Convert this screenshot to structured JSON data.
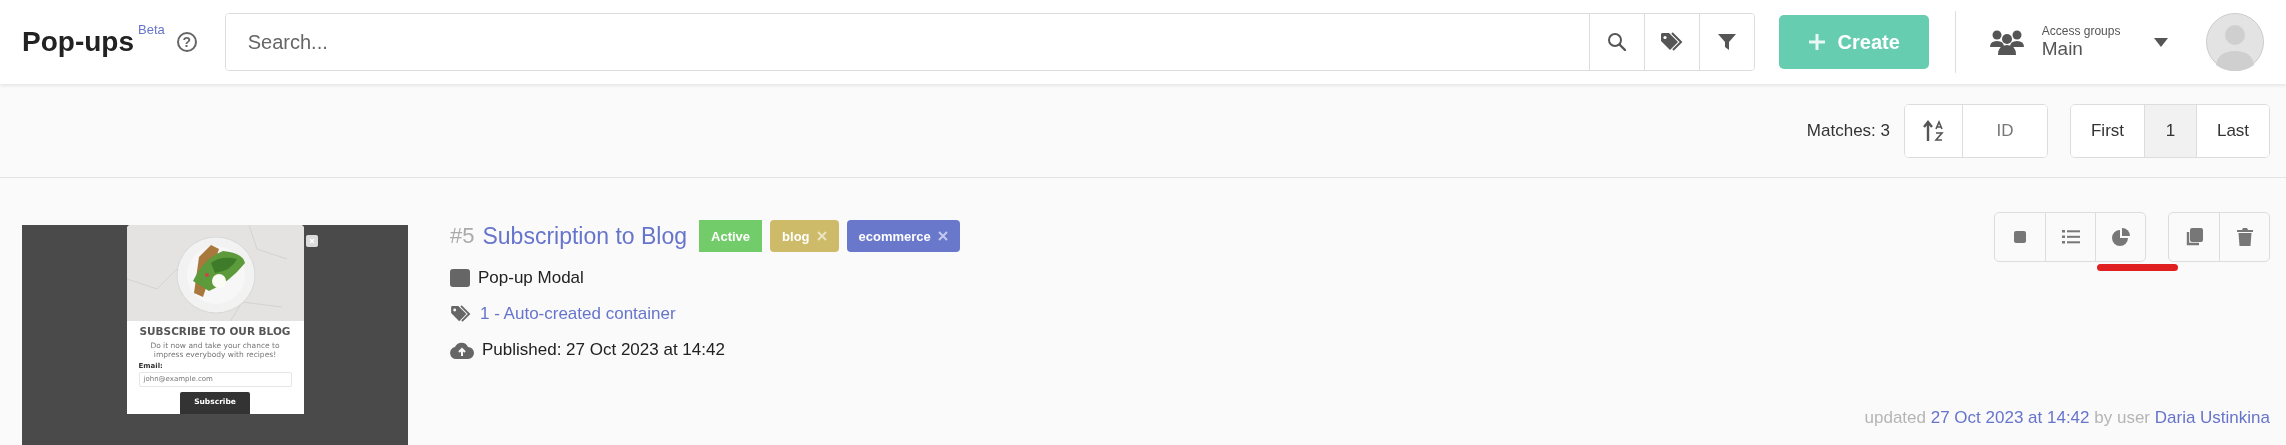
{
  "header": {
    "title": "Pop-ups",
    "badge": "Beta",
    "help_icon": "?",
    "search": {
      "placeholder": "Search..."
    },
    "create_button": "Create",
    "access_groups": {
      "label": "Access groups",
      "value": "Main"
    }
  },
  "toolbar": {
    "matches": "Matches: 3",
    "sort_field": "ID",
    "pagination": [
      {
        "label": "First",
        "selected": false
      },
      {
        "label": "1",
        "selected": true
      },
      {
        "label": "Last",
        "selected": false
      }
    ]
  },
  "items": [
    {
      "number": "#5",
      "title": "Subscription to Blog",
      "tags": [
        {
          "label": "Active",
          "color": "#72cc6a",
          "kind": "status"
        },
        {
          "label": "blog",
          "color": "#cdbb69",
          "kind": "removable"
        },
        {
          "label": "ecommerce",
          "color": "#6a78cc",
          "kind": "removable"
        }
      ],
      "type": "Pop-up Modal",
      "container": "1 - Auto-created container",
      "published": "Published: 27 Oct 2023 at 14:42",
      "preview": {
        "heading": "SUBSCRIBE TO OUR BLOG",
        "text": "Do it now and take your chance to impress everybody with recipes!",
        "email_label": "Email:",
        "email_placeholder": "john@example.com",
        "button": "Subscribe"
      },
      "action_groups": [
        [
          {
            "kind": "stop",
            "marked": false
          },
          {
            "kind": "list",
            "marked": false
          },
          {
            "kind": "stats",
            "marked": true
          }
        ],
        [
          {
            "kind": "copy",
            "marked": false
          },
          {
            "kind": "delete",
            "marked": false
          }
        ]
      ],
      "updated": {
        "prefix": "updated",
        "date": "27 Oct 2023 at 14:42",
        "by": "by user",
        "user": "Daria Ustinkina"
      }
    }
  ]
}
